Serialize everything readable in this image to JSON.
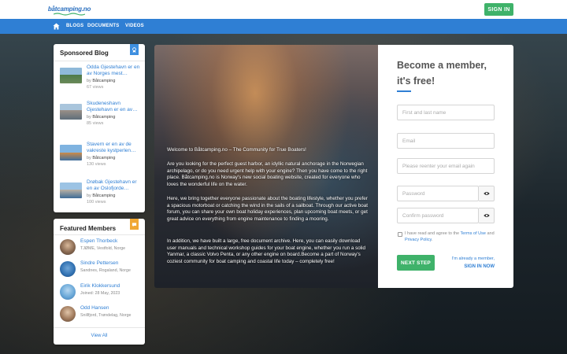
{
  "header": {
    "logo_text": "båtcamping.no",
    "signin_label": "SIGN IN"
  },
  "nav": {
    "items": [
      "BLOGS",
      "DOCUMENTS",
      "VIDEOS"
    ]
  },
  "sponsored": {
    "title": "Sponsored Blog",
    "by_prefix": "by",
    "items": [
      {
        "title": "Odda Gjestehavn er en av Norges mest…",
        "author": "Båtcamping",
        "views": "67 views"
      },
      {
        "title": "Skudeneshavn Gjestehavn er en av…",
        "author": "Båtcamping",
        "views": "85 views"
      },
      {
        "title": "Stavern er en av de vakreste kystperlen…",
        "author": "Båtcamping",
        "views": "130 views"
      },
      {
        "title": "Drøbak Gjestehavn er en av Oslofjorde…",
        "author": "Båtcamping",
        "views": "100 views"
      }
    ]
  },
  "featured": {
    "title": "Featured Members",
    "members": [
      {
        "name": "Espen Thorbeck",
        "sub": "TJØME, Vestfold, Norge"
      },
      {
        "name": "Sindre Pettersen",
        "sub": "Sandnes, Rogaland, Norge"
      },
      {
        "name": "Eirik Klokkersund",
        "sub": "Joined: 28 May, 2023"
      },
      {
        "name": "Odd Hansen",
        "sub": "Snillfjord, Trøndelag, Norge"
      }
    ],
    "view_all": "View All"
  },
  "hero": {
    "paragraphs": [
      "Welcome to Båtcamping.no – The Community for True Boaters!",
      "Are you looking for the perfect guest harbor, an idyllic natural anchorage in the Norwegian archipelago, or do you need urgent help with your engine? Then you have come to the right place. Båtcamping.no is Norway's new social boating website, created for everyone who loves the wonderful life on the water.",
      "Here, we bring together everyone passionate about the boating lifestyle, whether you prefer a spacious motorboat or catching the wind in the sails of a sailboat. Through our active boat forum, you can share your own boat holiday experiences, plan upcoming boat meets, or get great advice on everything from engine maintenance to finding a mooring.",
      "In addition, we have built a large, free document archive. Here, you can easily download user manuals and technical workshop guides for your boat engine, whether you run a solid Yanmar, a classic Volvo Penta, or any other engine on board.Become a part of Norway's coziest community for boat camping and coastal life today – completely free!"
    ]
  },
  "signup": {
    "title": "Become a member, it's free!",
    "name_placeholder": "First and last name",
    "email_placeholder": "Email",
    "email_confirm_placeholder": "Please reenter your email again",
    "password_placeholder": "Password",
    "password_confirm_placeholder": "Confirm password",
    "terms_prefix": "I have read and agree to the",
    "terms_link": "Terms of Use",
    "terms_and": "and",
    "privacy_link": "Privacy Policy",
    "terms_suffix": ".",
    "next_label": "NEXT STEP",
    "already_label": "I'm already a member,",
    "signin_now_label": "SIGN IN NOW"
  },
  "colors": {
    "nav_blue": "#2f7fd4",
    "accent_green": "#3fb26a",
    "ribbon_orange": "#f0a733"
  }
}
